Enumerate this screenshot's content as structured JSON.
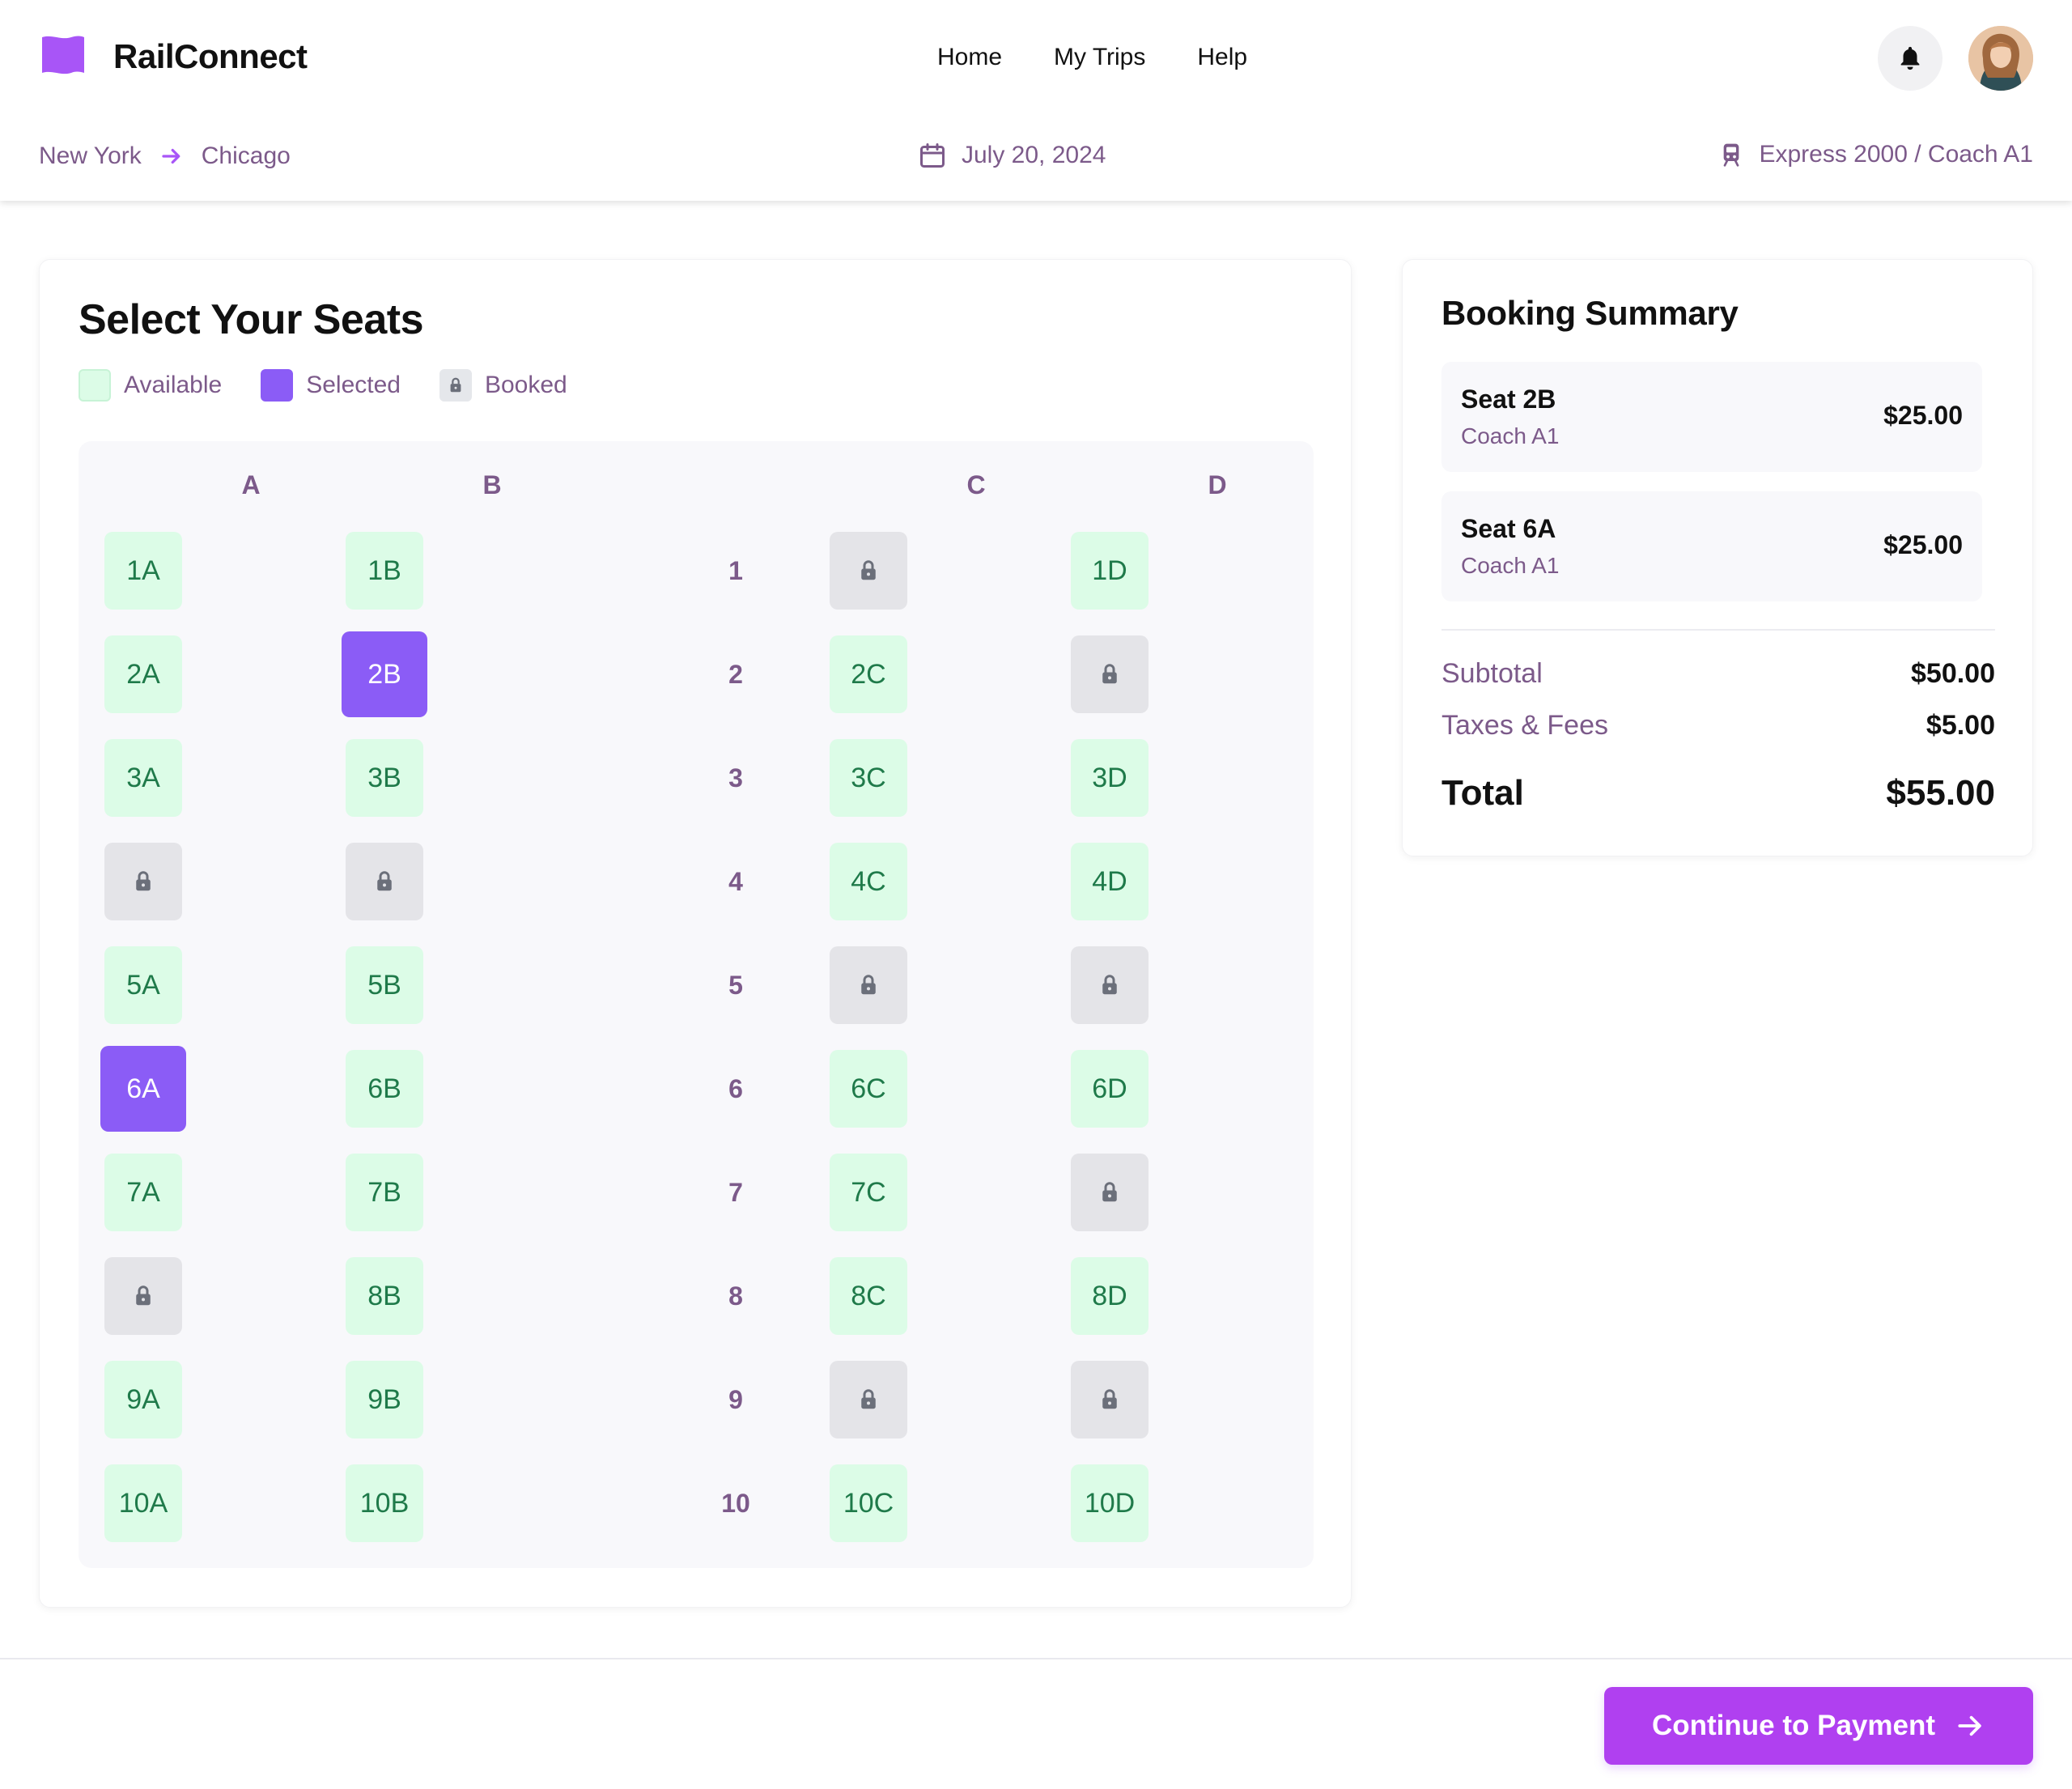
{
  "app": {
    "name": "RailConnect"
  },
  "nav": {
    "items": [
      "Home",
      "My Trips",
      "Help"
    ]
  },
  "trip": {
    "origin": "New York",
    "destination": "Chicago",
    "date": "July 20, 2024",
    "train": "Express 2000 / Coach A1"
  },
  "seat_selection": {
    "title": "Select Your Seats",
    "legend": {
      "available": "Available",
      "selected": "Selected",
      "booked": "Booked"
    },
    "columns": [
      "A",
      "B",
      "C",
      "D"
    ],
    "rows": [
      {
        "number": "1",
        "seats": [
          {
            "label": "1A",
            "status": "available"
          },
          {
            "label": "1B",
            "status": "available"
          },
          {
            "label": "",
            "status": "booked"
          },
          {
            "label": "1D",
            "status": "available"
          }
        ]
      },
      {
        "number": "2",
        "seats": [
          {
            "label": "2A",
            "status": "available"
          },
          {
            "label": "2B",
            "status": "selected"
          },
          {
            "label": "2C",
            "status": "available"
          },
          {
            "label": "",
            "status": "booked"
          }
        ]
      },
      {
        "number": "3",
        "seats": [
          {
            "label": "3A",
            "status": "available"
          },
          {
            "label": "3B",
            "status": "available"
          },
          {
            "label": "3C",
            "status": "available"
          },
          {
            "label": "3D",
            "status": "available"
          }
        ]
      },
      {
        "number": "4",
        "seats": [
          {
            "label": "",
            "status": "booked"
          },
          {
            "label": "",
            "status": "booked"
          },
          {
            "label": "4C",
            "status": "available"
          },
          {
            "label": "4D",
            "status": "available"
          }
        ]
      },
      {
        "number": "5",
        "seats": [
          {
            "label": "5A",
            "status": "available"
          },
          {
            "label": "5B",
            "status": "available"
          },
          {
            "label": "",
            "status": "booked"
          },
          {
            "label": "",
            "status": "booked"
          }
        ]
      },
      {
        "number": "6",
        "seats": [
          {
            "label": "6A",
            "status": "selected"
          },
          {
            "label": "6B",
            "status": "available"
          },
          {
            "label": "6C",
            "status": "available"
          },
          {
            "label": "6D",
            "status": "available"
          }
        ]
      },
      {
        "number": "7",
        "seats": [
          {
            "label": "7A",
            "status": "available"
          },
          {
            "label": "7B",
            "status": "available"
          },
          {
            "label": "7C",
            "status": "available"
          },
          {
            "label": "",
            "status": "booked"
          }
        ]
      },
      {
        "number": "8",
        "seats": [
          {
            "label": "",
            "status": "booked"
          },
          {
            "label": "8B",
            "status": "available"
          },
          {
            "label": "8C",
            "status": "available"
          },
          {
            "label": "8D",
            "status": "available"
          }
        ]
      },
      {
        "number": "9",
        "seats": [
          {
            "label": "9A",
            "status": "available"
          },
          {
            "label": "9B",
            "status": "available"
          },
          {
            "label": "",
            "status": "booked"
          },
          {
            "label": "",
            "status": "booked"
          }
        ]
      },
      {
        "number": "10",
        "seats": [
          {
            "label": "10A",
            "status": "available"
          },
          {
            "label": "10B",
            "status": "available"
          },
          {
            "label": "10C",
            "status": "available"
          },
          {
            "label": "10D",
            "status": "available"
          }
        ]
      }
    ]
  },
  "summary": {
    "title": "Booking Summary",
    "items": [
      {
        "seat": "Seat 2B",
        "coach": "Coach A1",
        "price": "$25.00"
      },
      {
        "seat": "Seat 6A",
        "coach": "Coach A1",
        "price": "$25.00"
      }
    ],
    "subtotal_label": "Subtotal",
    "subtotal": "$50.00",
    "taxes_label": "Taxes & Fees",
    "taxes": "$5.00",
    "total_label": "Total",
    "total": "$55.00"
  },
  "footer": {
    "continue_label": "Continue to Payment"
  },
  "colors": {
    "brand": "#a855f7",
    "selected_seat": "#8b5cf6",
    "available_seat": "#dcfce7",
    "available_text": "#1f7a4a",
    "booked_seat": "#e4e4e8",
    "muted_text": "#7c5a8a"
  },
  "icons": {
    "logo": "flag-icon",
    "notifications": "bell-icon",
    "route_arrow": "arrow-right-icon",
    "date": "calendar-icon",
    "train": "train-icon",
    "booked": "lock-icon",
    "continue": "arrow-right-icon"
  }
}
